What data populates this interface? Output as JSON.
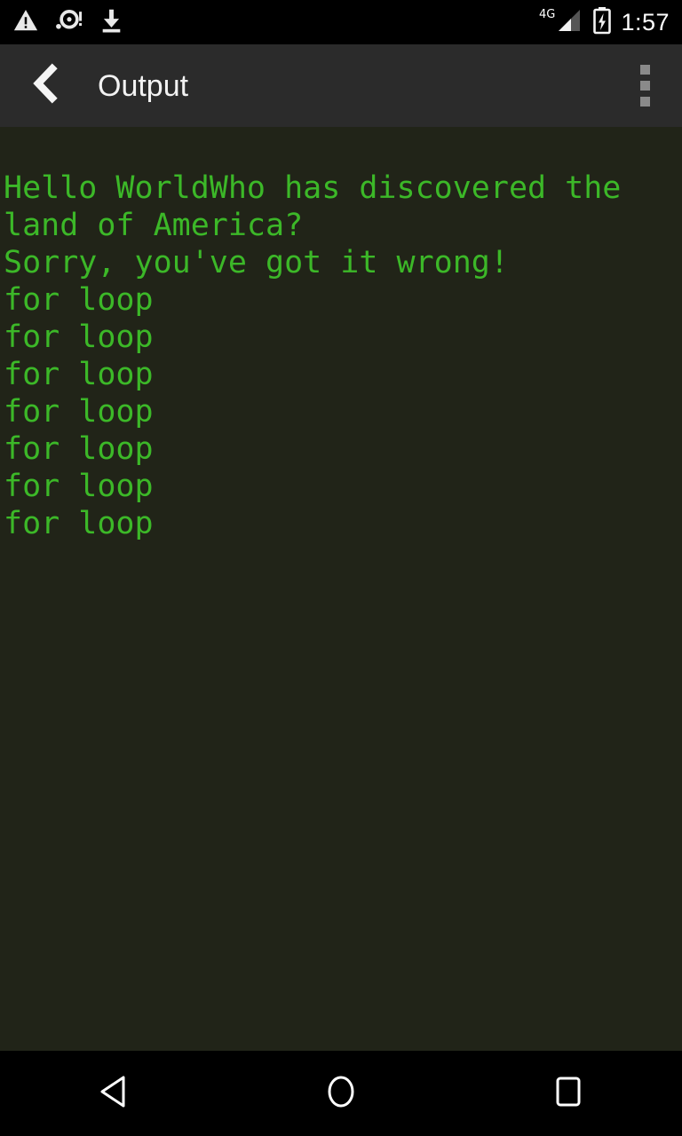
{
  "status_bar": {
    "icons_left": [
      {
        "name": "warning-triangle-icon",
        "label": "warning"
      },
      {
        "name": "disc-alert-icon",
        "label": "storage alert"
      },
      {
        "name": "download-icon",
        "label": "download"
      }
    ],
    "network_label": "4G",
    "signal_icon": "signal-bars-icon",
    "battery_icon": "battery-charging-icon",
    "time": "1:57",
    "background_color": "#000000",
    "foreground_color": "#ffffff"
  },
  "app_bar": {
    "back_icon": "chevron-left-icon",
    "title": "Output",
    "overflow_icon": "overflow-menu-icon",
    "background_color": "#2b2b2b",
    "title_color": "#f2f2f2"
  },
  "console": {
    "background_color": "#212418",
    "text_color": "#3cb828",
    "lines": [
      "Hello WorldWho has discovered the land of America?",
      "Sorry, you've got it wrong!",
      "for loop",
      "for loop",
      "for loop",
      "for loop",
      "for loop",
      "for loop",
      "for loop"
    ],
    "text": "Hello WorldWho has discovered the land of America?\nSorry, you've got it wrong!\nfor loop\nfor loop\nfor loop\nfor loop\nfor loop\nfor loop\nfor loop"
  },
  "nav_bar": {
    "background_color": "#000000",
    "buttons": [
      {
        "name": "nav-back-button",
        "label": "Back"
      },
      {
        "name": "nav-home-button",
        "label": "Home"
      },
      {
        "name": "nav-recents-button",
        "label": "Recents"
      }
    ]
  }
}
